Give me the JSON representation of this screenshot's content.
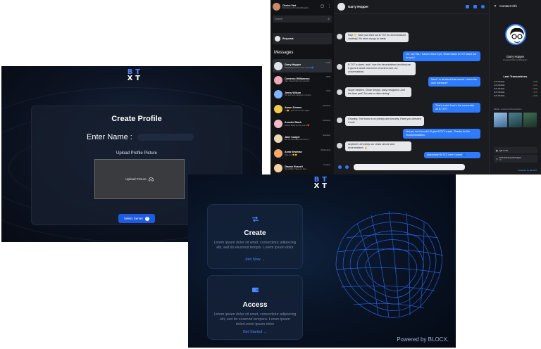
{
  "brand": {
    "line1": [
      "B",
      "T"
    ],
    "line2": [
      "X",
      "T"
    ]
  },
  "profile": {
    "title": "Create Profile",
    "name_label": "Enter Name :",
    "name_value": "",
    "upload_label": "Upload Profile Picture",
    "upload_button": "Upload Picture",
    "select_server": "Select Server"
  },
  "chat": {
    "sidebar": {
      "user_name": "Charles Paul",
      "user_sub": "Entrepreneur/Innovator/Metaphor...",
      "search_placeholder": "Search",
      "requests_label": "Requests",
      "messages_heading": "Messages",
      "conversations": [
        {
          "name": "Garry Hopper",
          "preview": "Absolutely! B.TXT, here I come! 🔵",
          "time": "17:56"
        },
        {
          "name": "Cameron Williamson",
          "preview": "Hey, I heard that you recently ...",
          "time": "15:09"
        },
        {
          "name": "Jenny Wilson",
          "preview": "Sir next Let's hangout on Sund...",
          "time": "14:02"
        },
        {
          "name": "Aaron Zimmer",
          "preview": "Hi 🙂 I just went to here right...",
          "time": "Yesterday"
        },
        {
          "name": "Annette Black",
          "preview": "Ooooh thank you so much ❤️",
          "time": "Yesterday"
        },
        {
          "name": "Jane Cooper",
          "preview": "But I'm not really sure how it ...",
          "time": "Yesterday"
        },
        {
          "name": "Anna Newman",
          "preview": "Nice one 😄😄",
          "time": "Wednesday"
        },
        {
          "name": "Dianne Russell",
          "preview": "No problem! See you then",
          "time": "Tuesday"
        }
      ]
    },
    "main": {
      "contact_name": "Garry Hopper",
      "messages": [
        {
          "dir": "in",
          "text": "Hey! 👋 Have you tried out B.TXT for decentralised chatting? It's been my go-to lately."
        },
        {
          "dir": "out",
          "text": "Oh, hey! No, I haven't tried it yet. What makes B.TXT stand out for you?"
        },
        {
          "dir": "in",
          "text": "B.TXT is sleek, and I love the decentralised architecture. It gives a whole new level of control over our conversations."
        },
        {
          "dir": "out",
          "text": "Nice! I'm all about that control. How's the user interface?"
        },
        {
          "dir": "in",
          "text": "Super intuitive. Clean design, easy navigation. And the best part? No ads or data mining!"
        },
        {
          "dir": "out",
          "text": "That's a win! How's the community on B.TXT?"
        },
        {
          "dir": "in",
          "text": "Growing. The focus is on privacy and security. Have you checked it out?"
        },
        {
          "dir": "out",
          "text": "Not yet, but I'm sold! I'll give B.TXT a spin. Thanks for the recommendation."
        },
        {
          "dir": "in",
          "text": "Anytime! Let's keep our chats secure and decentralised. 🔒"
        },
        {
          "dir": "out",
          "text": "Absolutely! B.TXT, here I come! 🔵"
        }
      ]
    },
    "contact": {
      "title": "Contact Info",
      "name": "Garry Hopper",
      "sub": "Designer/Influencer/Metaphor",
      "tx_title": "Last Transactions",
      "transactions": [
        {
          "id": "0x7170b6d4c",
          "amount": "+100$",
          "color": "#35c46b"
        },
        {
          "id": "0x7170b6d4c",
          "amount": "-200$",
          "color": "#e5484d"
        },
        {
          "id": "0x7170b6d4c",
          "amount": "+300$",
          "color": "#35c46b"
        },
        {
          "id": "0x7170b6d4c",
          "amount": "-400$",
          "color": "#e5484d"
        },
        {
          "id": "0x7170b6d4c",
          "amount": "+700$",
          "color": "#35c46b"
        }
      ],
      "media_label": "Media, Links and Documents",
      "option_qr": "QR Code",
      "option_self_delete": "Self Deleting Messages",
      "option_self_delete_sub": "Off",
      "powered": "Powered by BLOCX"
    }
  },
  "landing": {
    "create": {
      "title": "Create",
      "body": "Lorem ipsum dolor sit amet, consectetur adipiscing elit, sed do eiusmod tempor. Lorem ipsum dolor",
      "link": "Join Now"
    },
    "access": {
      "title": "Access",
      "body": "Lorem ipsum dolor sit amet, consectetur adipiscing elit, sed do eiusmod tempora. Lorem ipsum dolorLorem ipsum dolor",
      "link": "Get Started"
    },
    "powered": "Powered by BLOCX."
  },
  "colors": {
    "accent": "#2f7bff",
    "brand_blue": "#4f86ff",
    "positive": "#35c46b",
    "negative": "#e5484d"
  }
}
